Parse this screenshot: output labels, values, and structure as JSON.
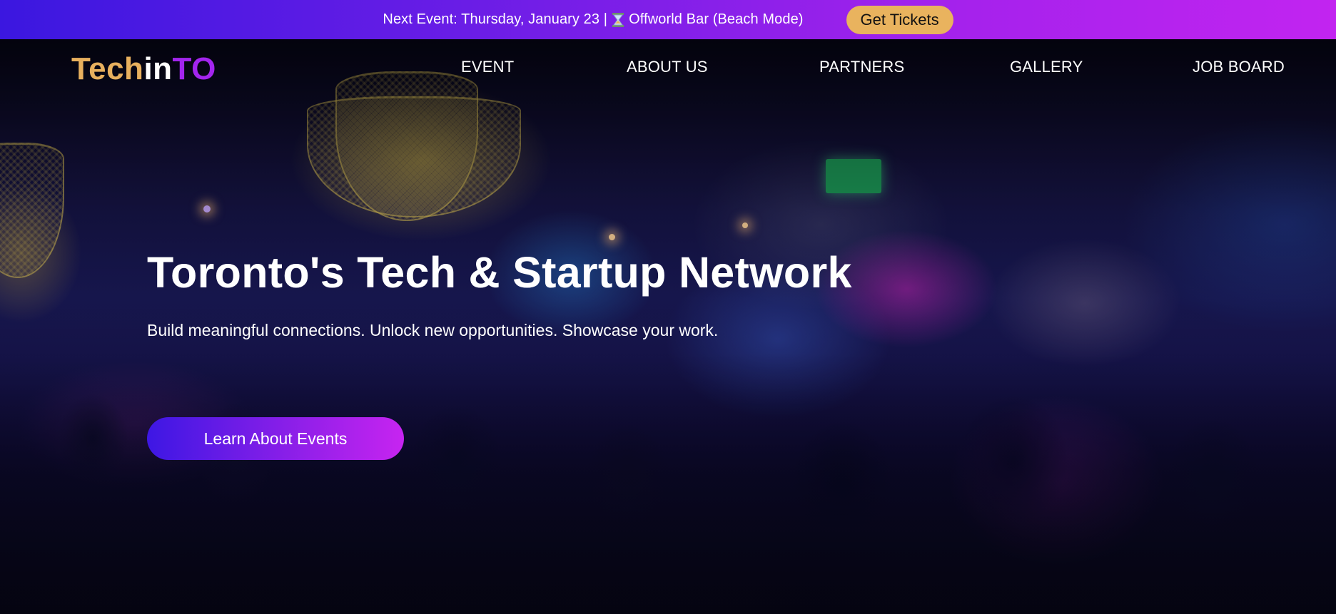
{
  "announcement": {
    "text_prefix": "Next Event: Thursday, January 23 |",
    "icon": "hourglass-icon",
    "text_suffix": "Offworld Bar (Beach Mode)",
    "button_label": "Get Tickets"
  },
  "logo": {
    "part1": "Tech",
    "part2": "in",
    "part3": "TO"
  },
  "nav": {
    "items": [
      {
        "label": "EVENT"
      },
      {
        "label": "ABOUT US"
      },
      {
        "label": "PARTNERS"
      },
      {
        "label": "GALLERY"
      },
      {
        "label": "JOB BOARD"
      }
    ]
  },
  "hero": {
    "title": "Toronto's Tech & Startup Network",
    "subtitle": "Build meaningful connections. Unlock new opportunities. Showcase your work.",
    "cta_label": "Learn About Events"
  },
  "colors": {
    "bar_gradient_start": "#3b17e0",
    "bar_gradient_end": "#c224f0",
    "ticket_button": "#e9b35e",
    "logo_gold": "#e8b05e",
    "logo_purple": "#a325ee"
  }
}
